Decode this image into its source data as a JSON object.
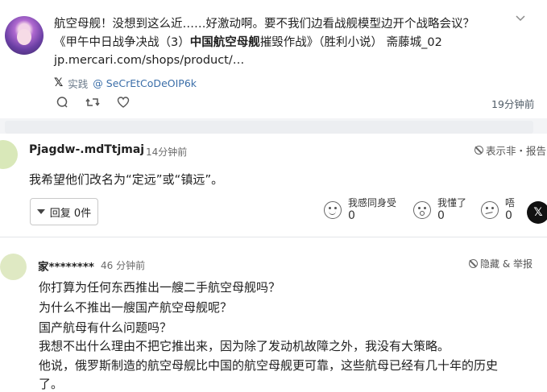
{
  "post": {
    "line1": "航空母舰！没想到这么近……好激动啊。要不我们边看战舰模型边开个战略会议？",
    "line2_prefix": "《甲午中日战争决战（3）",
    "line2_bold": "中国航空母舰",
    "line2_suffix": "摧毁作战》（胜利小说） 斋藤城_02",
    "link": "jp.mercari.com/shops/product/…",
    "source_platform_icon": "x-icon",
    "source_label": "实践",
    "handle": "@ SeCrEtCoDeOIP6k",
    "time": "19分钟前",
    "actions": [
      "comment-icon",
      "repost-icon",
      "like-icon"
    ]
  },
  "comment1": {
    "name": "Pjagdw-.mdTtjmaj",
    "time": "14分钟前",
    "hide_label": "表示非・报告",
    "body": "我希望他们改名为“定远”或“镇远”。",
    "reply_label": "回复 0件",
    "reactions": [
      {
        "label": "我感同身受",
        "count": "0",
        "icon": "smile-icon"
      },
      {
        "label": "我懂了",
        "count": "0",
        "icon": "surprised-icon"
      },
      {
        "label": "唔",
        "count": "0",
        "icon": "confused-icon"
      }
    ],
    "share_icon": "x-icon"
  },
  "comment2": {
    "name": "家********",
    "time": "46 分钟前",
    "hide_label": "隐藏 & 举报",
    "lines": [
      "你打算为任何东西推出一艘二手航空母舰吗？",
      "为什么不推出一艘国产航空母舰呢？",
      "国产航母有什么问题吗？",
      "我想不出什么理由不把它推出来，因为除了发动机故障之外，我没有大策略。",
      "他说，俄罗斯制造的航空母舰比中国的航空母舰更可靠，这些航母已经有几十年的历史",
      "了。"
    ]
  }
}
